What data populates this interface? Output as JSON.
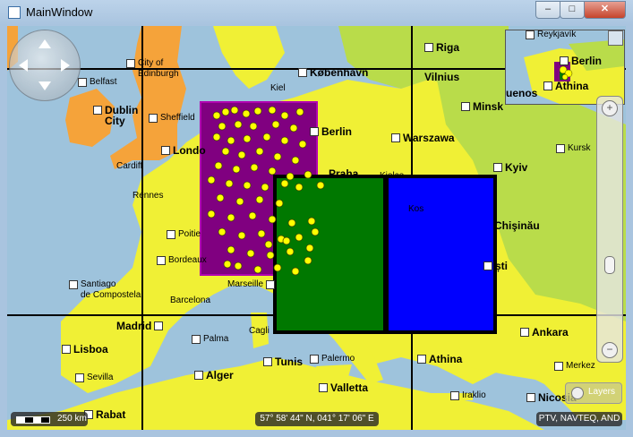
{
  "window": {
    "title": "MainWindow",
    "minimize_glyph": "–",
    "maximize_glyph": "□",
    "close_glyph": "✕"
  },
  "colors": {
    "water": "#9ec3dc",
    "land_yellow": "#f0f035",
    "land_orange": "#f5a33a",
    "land_green": "#b9dc4a",
    "region_purple": "#800080",
    "region_green": "#007800",
    "region_blue": "#0000ff",
    "pin_yellow": "#ffff00"
  },
  "cities": [
    {
      "name": "City of\nEdinburgh",
      "big": false
    },
    {
      "name": "Belfast",
      "big": false
    },
    {
      "name": "Dublin\nCity",
      "big": true
    },
    {
      "name": "Sheffield",
      "big": false
    },
    {
      "name": "Cardiff",
      "big": false
    },
    {
      "name": "Londo",
      "big": true
    },
    {
      "name": "Rennes",
      "big": false
    },
    {
      "name": "Poitie",
      "big": false
    },
    {
      "name": "Bordeaux",
      "big": false
    },
    {
      "name": "Santiago\nde Compostela",
      "big": false
    },
    {
      "name": "Barcelona",
      "big": false
    },
    {
      "name": "Marseille",
      "big": false
    },
    {
      "name": "Madrid",
      "big": true
    },
    {
      "name": "Lisboa",
      "big": true
    },
    {
      "name": "Sevilla",
      "big": false
    },
    {
      "name": "Palma",
      "big": false
    },
    {
      "name": "Cagli",
      "big": false
    },
    {
      "name": "Tunis",
      "big": true
    },
    {
      "name": "Alger",
      "big": true
    },
    {
      "name": "Rabat",
      "big": true
    },
    {
      "name": "Palermo",
      "big": false
    },
    {
      "name": "Valletta",
      "big": true
    },
    {
      "name": "Athina",
      "big": true
    },
    {
      "name": "Iraklio",
      "big": false
    },
    {
      "name": "Nicosia",
      "big": true
    },
    {
      "name": "Ankara",
      "big": true
    },
    {
      "name": "Merkez",
      "big": false
    },
    {
      "name": "Chişinău",
      "big": true
    },
    {
      "name": "ști",
      "big": true
    },
    {
      "name": "Kyiv",
      "big": true
    },
    {
      "name": "Kursk",
      "big": false
    },
    {
      "name": "Minsk",
      "big": true
    },
    {
      "name": "Vilnius",
      "big": true
    },
    {
      "name": "Riga",
      "big": true
    },
    {
      "name": "København",
      "big": true
    },
    {
      "name": "Kiel",
      "big": false
    },
    {
      "name": "Berlin",
      "big": true
    },
    {
      "name": "Warszawa",
      "big": true
    },
    {
      "name": "Praha",
      "big": true
    },
    {
      "name": "Kielce",
      "big": false
    },
    {
      "name": "Kos",
      "big": false
    }
  ],
  "minimap": {
    "labels": [
      "Reykjavík",
      "Berlin",
      "Athina",
      "uenos"
    ]
  },
  "zoom": {
    "plus_glyph": "+",
    "minus_glyph": "−",
    "level": 0.32
  },
  "layers_button": {
    "label": "Layers",
    "icon": "layers-icon"
  },
  "scale": {
    "label": "250 km"
  },
  "coordinates": "57° 58' 44\" N, 041° 17' 06\" E",
  "copyright": "PTV, NAVTEQ, AND"
}
